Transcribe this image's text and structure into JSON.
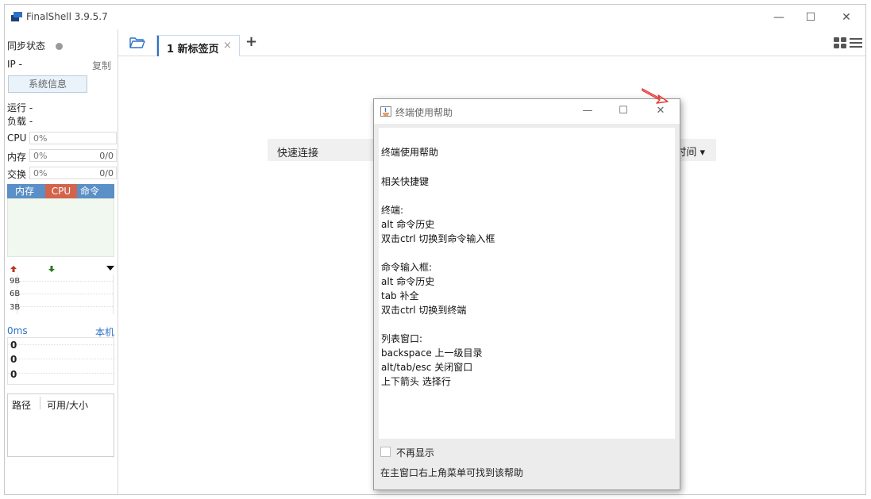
{
  "window": {
    "title": "FinalShell 3.9.5.7",
    "controls": [
      "—",
      "☐",
      "✕"
    ]
  },
  "sidebar": {
    "sync_status": "同步状态",
    "ip_label": "IP -",
    "copy_label": "复制",
    "sysinfo_button": "系统信息",
    "run_label": "运行 -",
    "load_label": "负载 -",
    "cpu": {
      "label": "CPU",
      "value": "0%"
    },
    "mem": {
      "label": "内存",
      "value": "0%",
      "max": "0/0"
    },
    "swap": {
      "label": "交换",
      "value": "0%",
      "max": "0/0"
    },
    "proc_headers": [
      "内存",
      "CPU",
      "命令"
    ],
    "proc_colors": [
      "#5b8fc7",
      "#d3634b",
      "#5b8fc7"
    ],
    "net_scale": [
      "9B",
      "6B",
      "3B"
    ],
    "ping_label": "0ms",
    "ping_target": "本机",
    "ping_values": [
      "0",
      "0",
      "0"
    ],
    "fs_headers": [
      "路径",
      "可用/大小"
    ]
  },
  "tabs": {
    "items": [
      {
        "label": "1 新标签页",
        "close": "×"
      }
    ],
    "add_label": "+"
  },
  "main": {
    "quick_connect_label": "快速连接",
    "quick_right_text": "时间 ▾"
  },
  "dialog": {
    "title": "终端使用帮助",
    "controls": [
      "—",
      "☐",
      "✕"
    ],
    "lines": [
      "终端使用帮助",
      "相关快捷键",
      "终端:",
      "alt 命令历史",
      "双击ctrl 切换到命令输入框",
      "命令输入框:",
      "alt 命令历史",
      "tab 补全",
      "双击ctrl 切换到终端",
      "列表窗口:",
      "backspace 上一级目录",
      "alt/tab/esc 关闭窗口",
      "上下箭头 选择行"
    ],
    "dont_show_label": "不再显示",
    "footer": "在主窗口右上角菜单可找到该帮助"
  },
  "colors": {
    "accent": "#2e72c6",
    "arrow": "#e53935",
    "sysinfo_bg": "#eaf2fa"
  }
}
